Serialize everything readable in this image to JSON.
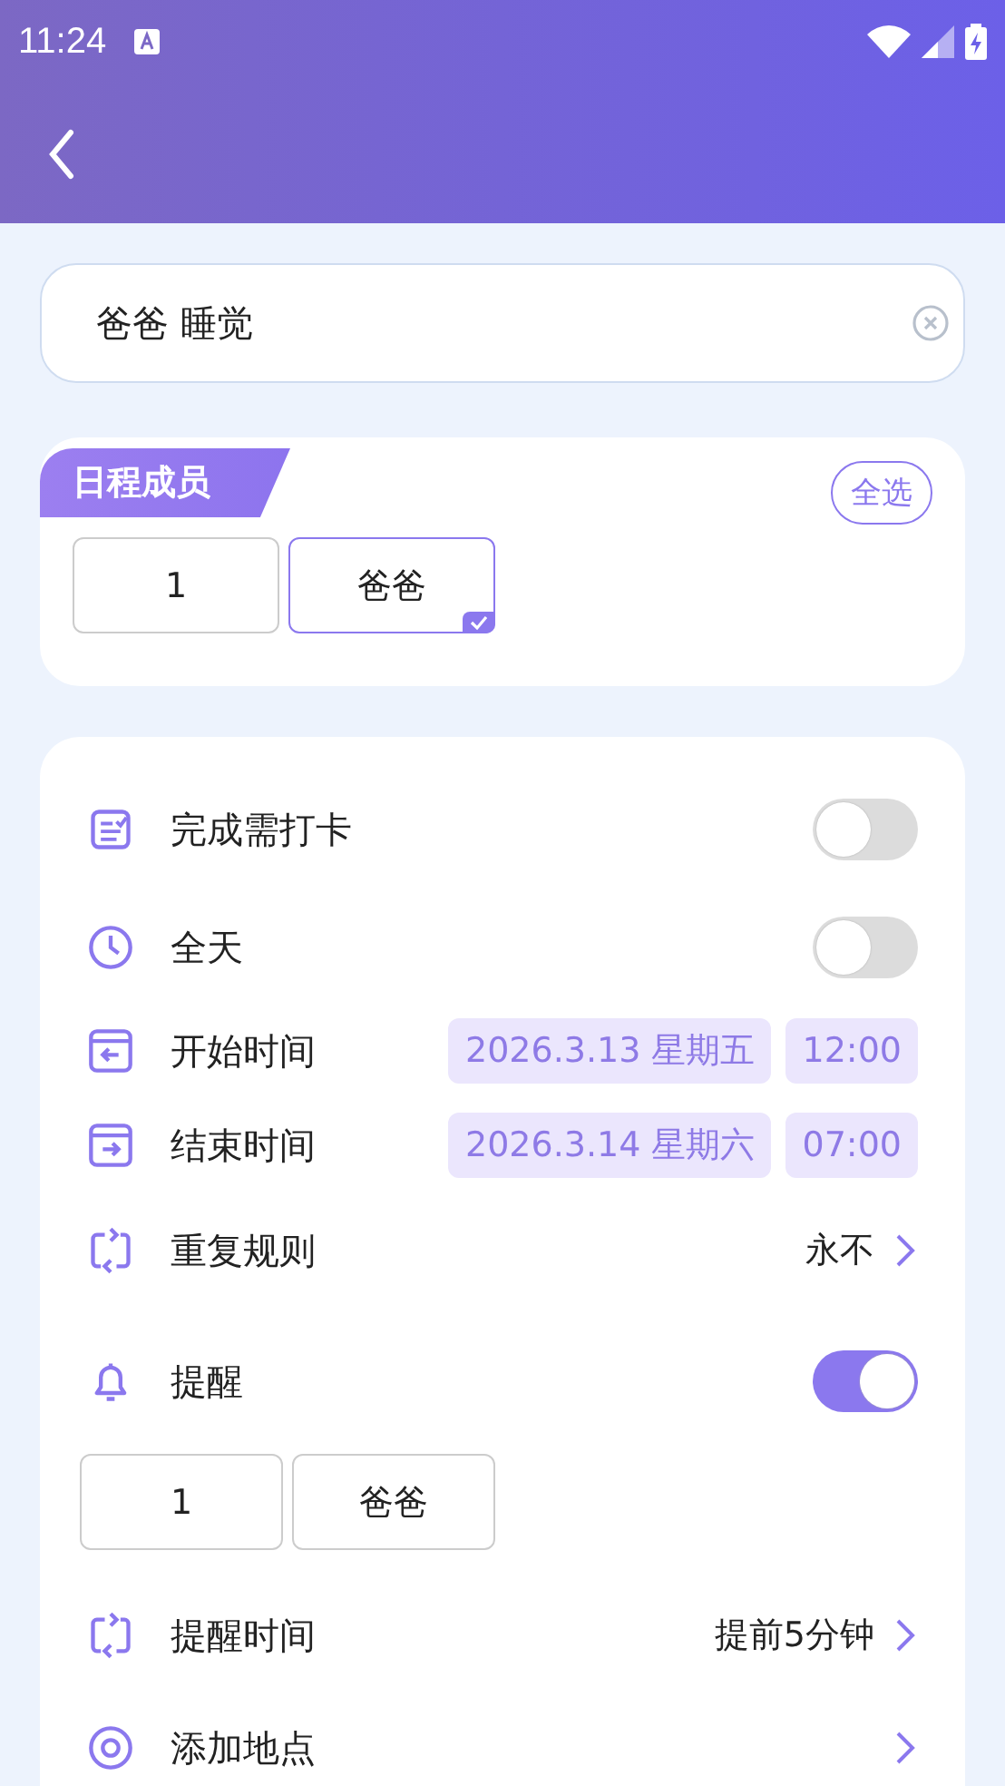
{
  "status_bar": {
    "time": "11:24"
  },
  "title_field": {
    "value": "爸爸 睡觉"
  },
  "members": {
    "title": "日程成员",
    "select_all": "全选",
    "chips": [
      {
        "label": "1",
        "selected": false
      },
      {
        "label": "爸爸",
        "selected": true
      }
    ]
  },
  "settings": [
    {
      "kind": "toggle",
      "label": "完成需打卡",
      "on": false
    },
    {
      "kind": "toggle",
      "label": "全天",
      "on": false
    },
    {
      "kind": "datetime",
      "label": "开始时间",
      "date": "2026.3.13 星期五",
      "time": "12:00"
    },
    {
      "kind": "datetime",
      "label": "结束时间",
      "date": "2026.3.14 星期六",
      "time": "07:00"
    },
    {
      "kind": "link",
      "label": "重复规则",
      "value": "永不"
    },
    {
      "kind": "toggle",
      "label": "提醒",
      "on": true
    },
    {
      "kind": "chips",
      "chips": [
        "1",
        "爸爸"
      ]
    },
    {
      "kind": "link",
      "label": "提醒时间",
      "value": "提前5分钟"
    },
    {
      "kind": "link",
      "label": "添加地点"
    }
  ]
}
